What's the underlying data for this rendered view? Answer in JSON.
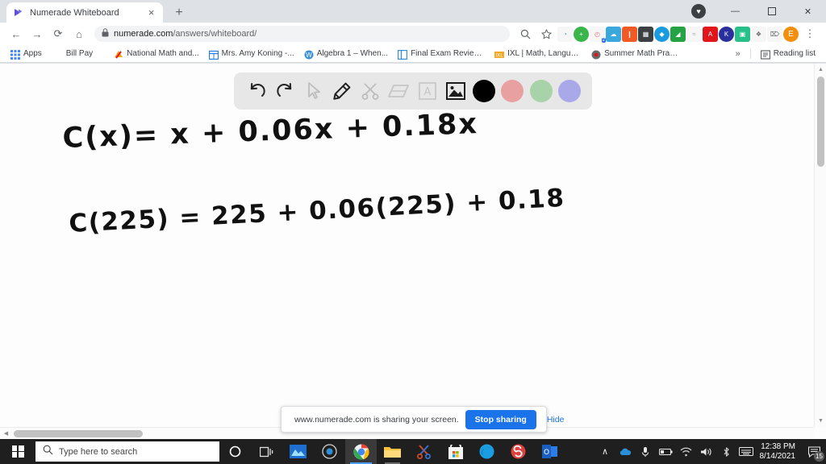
{
  "browser": {
    "tab": {
      "title": "Numerade Whiteboard",
      "close_label": "×",
      "favicon": "numerade-logo-icon"
    },
    "new_tab_label": "+",
    "window_controls": {
      "profile": "♥",
      "minimize": "—",
      "maximize": "❐",
      "close": "✕"
    },
    "nav": {
      "back": "←",
      "forward": "→",
      "reload": "⟳",
      "home": "⌂"
    },
    "omnibox": {
      "lock_icon": "lock-icon",
      "domain": "numerade.com",
      "path": "/answers/whiteboard/",
      "url": "numerade.com/answers/whiteboard/",
      "search_icon": "search-icon",
      "star_icon": "star-icon"
    },
    "extensions": [
      {
        "name": "pocket-extension",
        "color": "#f6f6f6",
        "glyph": "◔",
        "fg": "#2a9fd6"
      },
      {
        "name": "green-plus-extension",
        "color": "#39b54a",
        "glyph": "+",
        "fg": "#ffffff"
      },
      {
        "name": "kami-extension",
        "color": "#f6f6f6",
        "glyph": "◴",
        "fg": "#e8707a",
        "badge": "2"
      },
      {
        "name": "cloud-extension",
        "color": "#3aa7dd",
        "glyph": "☁",
        "fg": "#ffffff"
      },
      {
        "name": "bookmark-extension",
        "color": "#f15a24",
        "glyph": "❙",
        "fg": "#ffffff"
      },
      {
        "name": "grid-extension",
        "color": "#3c4043",
        "glyph": "▦",
        "fg": "#ffffff"
      },
      {
        "name": "blue-diamond-extension",
        "color": "#1a9be0",
        "glyph": "◆",
        "fg": "#ffffff"
      },
      {
        "name": "cast-extension",
        "color": "#25a244",
        "glyph": "◢",
        "fg": "#ffffff"
      },
      {
        "name": "grammarly-extension",
        "color": "#f6f6f6",
        "glyph": "≈",
        "fg": "#9aa0a6"
      },
      {
        "name": "adobe-pdf-extension",
        "color": "#e0161a",
        "glyph": "A",
        "fg": "#ffffff"
      },
      {
        "name": "kahoot-extension",
        "color": "#2a2f9e",
        "glyph": "K",
        "fg": "#ffffff"
      },
      {
        "name": "screencastify-extension",
        "color": "#27c08a",
        "glyph": "▣",
        "fg": "#ffffff"
      },
      {
        "name": "puzzle-extensions-icon",
        "color": "#f6f6f6",
        "glyph": "❖",
        "fg": "#5f6368"
      },
      {
        "name": "cast-icon",
        "color": "#f6f6f6",
        "glyph": "⎔",
        "fg": "#5f6368"
      },
      {
        "name": "profile-avatar",
        "color": "#f2900d",
        "glyph": "E",
        "fg": "#ffffff"
      }
    ],
    "menu_icon": "⋮",
    "bookmarks": [
      {
        "label": "Apps",
        "icon": "apps-grid-icon",
        "color": "#4285f4"
      },
      {
        "label": "Bill Pay",
        "icon": "blank-page-icon",
        "color": "transparent"
      },
      {
        "label": "National Math and...",
        "icon": "national-math-icon",
        "color": "#f5a623"
      },
      {
        "label": "Mrs. Amy Koning -...",
        "icon": "calendar-icon",
        "color": "#2b7de9"
      },
      {
        "label": "Algebra 1 – When...",
        "icon": "wordpress-icon",
        "color": "#3b8fd4"
      },
      {
        "label": "Final Exam Review -...",
        "icon": "window-icon",
        "color": "#3b8fd4"
      },
      {
        "label": "IXL | Math, Languag...",
        "icon": "ixl-icon",
        "color": "#f5a623"
      },
      {
        "label": "Summer Math Pract...",
        "icon": "target-icon",
        "color": "#6b6b6b"
      }
    ],
    "bookmarks_overflow": "»",
    "reading_list": {
      "label": "Reading list",
      "icon": "reading-list-icon"
    }
  },
  "whiteboard": {
    "tools": [
      {
        "name": "undo-tool",
        "glyph": "undo",
        "state": "enabled"
      },
      {
        "name": "redo-tool",
        "glyph": "redo",
        "state": "enabled"
      },
      {
        "name": "select-tool",
        "glyph": "cursor",
        "state": "inactive"
      },
      {
        "name": "pencil-tool",
        "glyph": "pencil",
        "state": "active"
      },
      {
        "name": "scissors-tool",
        "glyph": "scissors",
        "state": "inactive"
      },
      {
        "name": "eraser-tool",
        "glyph": "eraser",
        "state": "inactive"
      },
      {
        "name": "text-tool",
        "glyph": "text-a",
        "state": "inactive"
      },
      {
        "name": "image-tool",
        "glyph": "image",
        "state": "active"
      }
    ],
    "colors": [
      {
        "name": "color-black",
        "hex": "#000000",
        "selected": true
      },
      {
        "name": "color-pink",
        "hex": "#e8a0a0",
        "selected": false
      },
      {
        "name": "color-green",
        "hex": "#a8d3a8",
        "selected": false
      },
      {
        "name": "color-purple",
        "hex": "#a9a9ea",
        "selected": false
      }
    ],
    "ink": {
      "line1": "C(x)= x + 0.06x + 0.18x",
      "line2": "C(225) = 225 + 0.06(225) + 0.18"
    }
  },
  "share_bar": {
    "grip_icon": "drag-grip-icon",
    "message": "www.numerade.com is sharing your screen.",
    "stop_label": "Stop sharing",
    "hide_label": "Hide"
  },
  "taskbar": {
    "start_icon": "windows-start-icon",
    "search_placeholder": "Type here to search",
    "search_icon": "search-icon",
    "items": [
      {
        "name": "cortana-icon",
        "glyph": "○",
        "color": "#ffffff",
        "state": "idle"
      },
      {
        "name": "task-view-icon",
        "glyph": "⧉",
        "color": "#e8e8e8",
        "state": "idle"
      },
      {
        "name": "photos-app-icon",
        "glyph": "◧",
        "color": "#2e7fd4",
        "state": "idle"
      },
      {
        "name": "media-app-icon",
        "glyph": "◉",
        "color": "#cfcfcf",
        "state": "idle"
      },
      {
        "name": "chrome-icon",
        "glyph": "●",
        "color": "#4caf50",
        "state": "active"
      },
      {
        "name": "file-explorer-icon",
        "glyph": "▰",
        "color": "#ffc23d",
        "state": "open"
      },
      {
        "name": "snipping-tool-icon",
        "glyph": "✂",
        "color": "#e05a2b",
        "state": "idle"
      },
      {
        "name": "microsoft-store-icon",
        "glyph": "▦",
        "color": "#f2f2f2",
        "state": "idle"
      },
      {
        "name": "edge-icon",
        "glyph": "◔",
        "color": "#1b9de2",
        "state": "idle"
      },
      {
        "name": "sway-app-icon",
        "glyph": "S",
        "color": "#e0413e",
        "state": "idle"
      },
      {
        "name": "outlook-icon",
        "glyph": "▣",
        "color": "#2b7de9",
        "state": "idle"
      }
    ],
    "tray": [
      {
        "name": "show-hidden-icons",
        "glyph": "∧"
      },
      {
        "name": "onedrive-icon",
        "glyph": "☁"
      },
      {
        "name": "microphone-icon",
        "glyph": "⏺"
      },
      {
        "name": "battery-icon",
        "glyph": "▭"
      },
      {
        "name": "wifi-icon",
        "glyph": "◡"
      },
      {
        "name": "volume-icon",
        "glyph": "ᴘ"
      },
      {
        "name": "bluetooth-icon",
        "glyph": "ʘ"
      },
      {
        "name": "keyboard-icon",
        "glyph": "⌨"
      }
    ],
    "time": "12:38 PM",
    "date": "8/14/2021",
    "notifications": {
      "icon": "notification-icon",
      "count": "15"
    }
  },
  "scrollbars": {
    "vertical": {
      "up": "▲",
      "down": "▼"
    },
    "horizontal": {
      "left": "◀",
      "right": "▶"
    }
  }
}
